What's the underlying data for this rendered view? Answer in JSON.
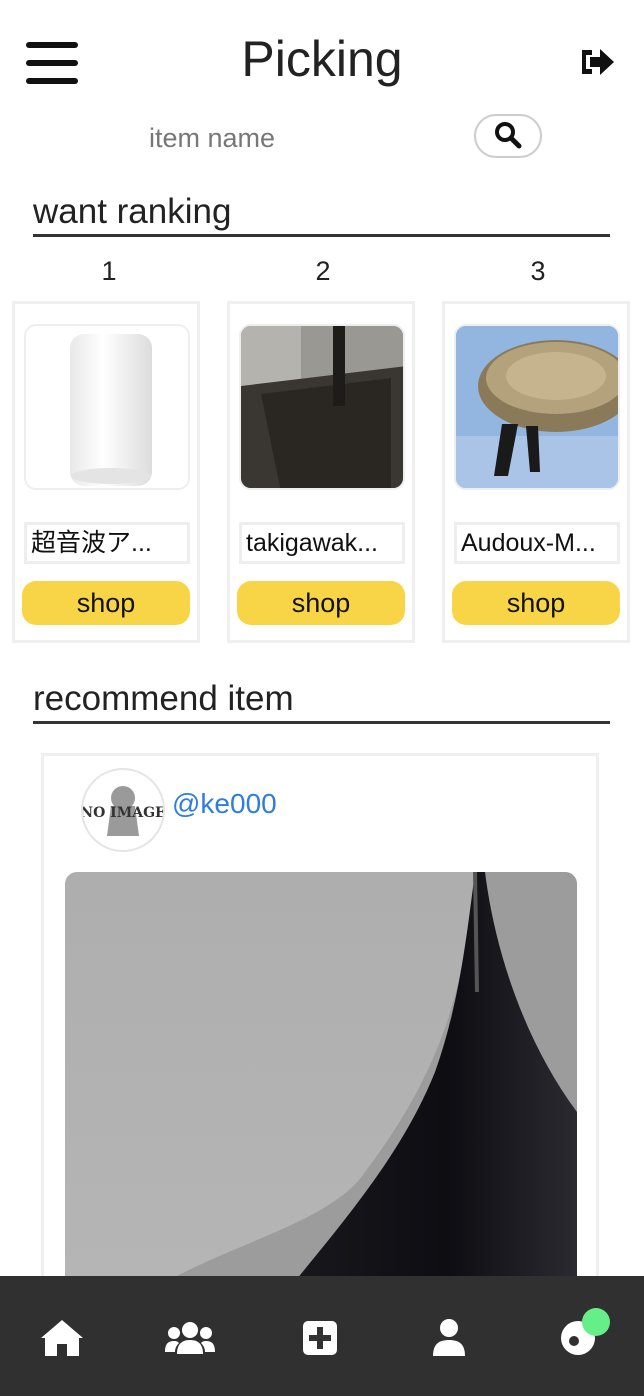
{
  "header": {
    "title": "Picking",
    "menu_icon": "hamburger-menu-icon",
    "logout_icon": "sign-out-icon"
  },
  "search": {
    "placeholder": "item name",
    "button_icon": "search-icon"
  },
  "ranking": {
    "title": "want ranking",
    "items": [
      {
        "rank": "1",
        "name": "超音波ア...",
        "button": "shop"
      },
      {
        "rank": "2",
        "name": "takigawak...",
        "button": "shop"
      },
      {
        "rank": "3",
        "name": "Audoux-M...",
        "button": "shop"
      }
    ]
  },
  "recommend": {
    "title": "recommend item",
    "post": {
      "avatar_text": "NO IMAGE",
      "username": "@ke000"
    }
  },
  "bottom_nav": {
    "items": [
      "home-icon",
      "users-icon",
      "plus-square-icon",
      "user-icon",
      "notifications-icon"
    ]
  },
  "colors": {
    "accent_yellow": "#f8d546",
    "link_blue": "#2f7de1",
    "nav_bg": "#303030",
    "notification_green": "#66ee88"
  }
}
